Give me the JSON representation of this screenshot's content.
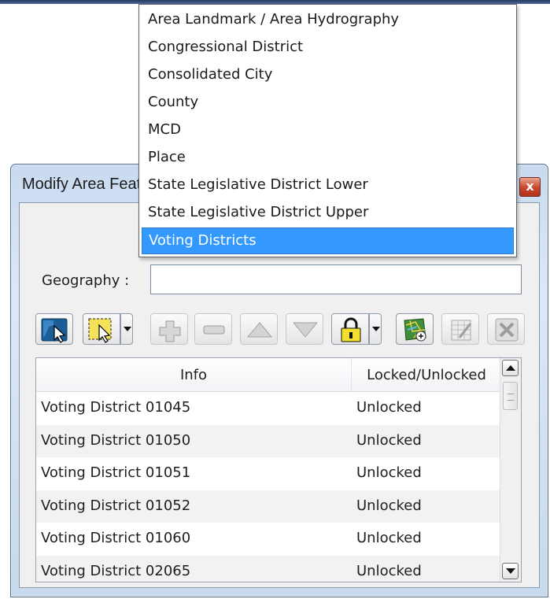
{
  "dialog": {
    "title": "Modify Area Features",
    "close_label": "x",
    "geography_label": "Geography :",
    "geography_value": "Voting Districts"
  },
  "toolbar": {
    "buttons": [
      {
        "id": "select-feature",
        "icon": "select-feature-icon",
        "enabled": true
      },
      {
        "id": "select-area",
        "icon": "select-area-icon",
        "enabled": true,
        "dropdown": true
      },
      {
        "id": "add",
        "icon": "plus-icon",
        "enabled": false
      },
      {
        "id": "remove",
        "icon": "minus-icon",
        "enabled": false
      },
      {
        "id": "move-up",
        "icon": "triangle-up-icon",
        "enabled": false
      },
      {
        "id": "move-down",
        "icon": "triangle-down-icon",
        "enabled": false
      },
      {
        "id": "lock",
        "icon": "lock-icon",
        "enabled": true,
        "dropdown": true
      },
      {
        "id": "map",
        "icon": "map-add-icon",
        "enabled": true
      },
      {
        "id": "edit-table",
        "icon": "table-edit-icon",
        "enabled": false
      },
      {
        "id": "delete",
        "icon": "x-icon",
        "enabled": false
      }
    ]
  },
  "table": {
    "columns": [
      "Info",
      "Locked/Unlocked"
    ],
    "rows": [
      [
        "Voting District 01045",
        "Unlocked"
      ],
      [
        "Voting District 01050",
        "Unlocked"
      ],
      [
        "Voting District 01051",
        "Unlocked"
      ],
      [
        "Voting District 01052",
        "Unlocked"
      ],
      [
        "Voting District 01060",
        "Unlocked"
      ],
      [
        "Voting District 02065",
        "Unlocked"
      ]
    ]
  },
  "dropdown": {
    "options": [
      "Area Landmark / Area Hydrography",
      "Congressional District",
      "Consolidated City",
      "County",
      "MCD",
      "Place",
      "State Legislative District Lower",
      "State Legislative District Upper",
      "Voting Districts"
    ],
    "selected_index": 8
  },
  "colors": {
    "selection": "#3399ff",
    "dialog_frame": "#c9daf0",
    "close_button": "#c9452b"
  }
}
